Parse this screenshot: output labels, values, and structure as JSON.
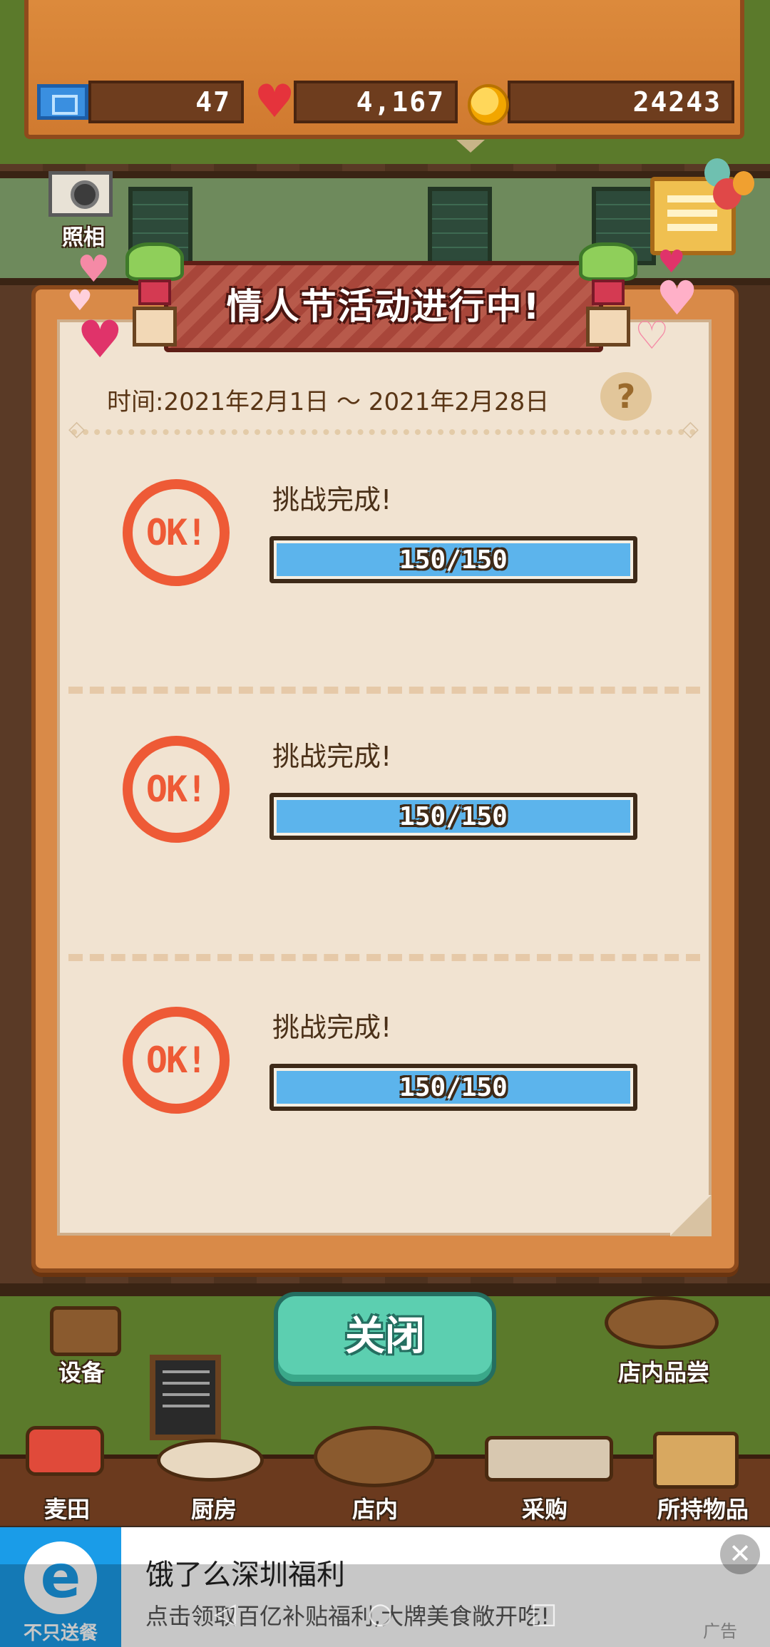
{
  "resources": {
    "tickets": "47",
    "hearts": "4,167",
    "coins": "24243"
  },
  "camera": {
    "label": "照相"
  },
  "event": {
    "title": "情人节活动进行中!",
    "date_range": "时间:2021年2月1日 ～ 2021年2月28日",
    "help": "?"
  },
  "challenges": [
    {
      "stamp": "OK!",
      "status": "挑战完成!",
      "progress_text": "150/150",
      "progress": 1.0
    },
    {
      "stamp": "OK!",
      "status": "挑战完成!",
      "progress_text": "150/150",
      "progress": 1.0
    },
    {
      "stamp": "OK!",
      "status": "挑战完成!",
      "progress_text": "150/150",
      "progress": 1.0
    }
  ],
  "close_button": "关闭",
  "shop_icons": {
    "equipment": "设备",
    "tasting": "店内品尝"
  },
  "nav": [
    "麦田",
    "厨房",
    "店内",
    "采购",
    "所持物品"
  ],
  "ad": {
    "logo_text": "不只送餐",
    "title": "饿了么深圳福利",
    "subtitle": "点击领取百亿补贴福利,大牌美食敞开吃!",
    "tag": "广告"
  },
  "colors": {
    "progress_fill": "#5cb4ec",
    "stamp": "#ee5a36",
    "close_button": "#5ccfb0",
    "ad_brand": "#1a9ce8"
  }
}
